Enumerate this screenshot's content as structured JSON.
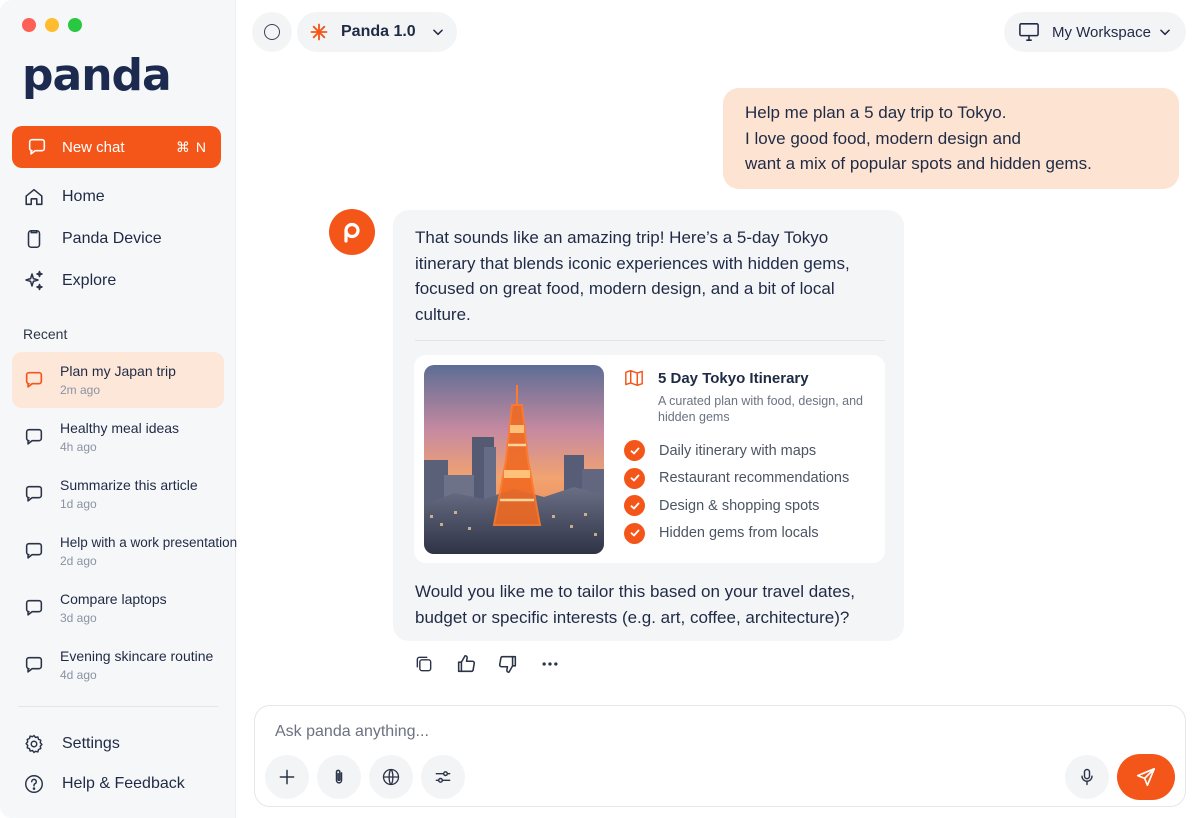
{
  "app": {
    "logo_text": "panda"
  },
  "sidebar": {
    "new_chat": {
      "label": "New chat",
      "shortcut": "⌘ N"
    },
    "nav": [
      {
        "label": "Home",
        "icon": "home-icon"
      },
      {
        "label": "Panda Device",
        "icon": "device-icon"
      },
      {
        "label": "Explore",
        "icon": "sparkle-icon"
      }
    ],
    "recent_label": "Recent",
    "recent": [
      {
        "title": "Plan my Japan trip",
        "ago": "2m ago",
        "active": true
      },
      {
        "title": "Healthy meal ideas",
        "ago": "4h ago"
      },
      {
        "title": "Summarize this article",
        "ago": "1d ago"
      },
      {
        "title": "Help with a work presentation",
        "ago": "2d ago"
      },
      {
        "title": "Compare laptops",
        "ago": "3d ago"
      },
      {
        "title": "Evening skincare routine",
        "ago": "4d ago"
      }
    ],
    "bottom": [
      {
        "label": "Settings",
        "icon": "gear-icon"
      },
      {
        "label": "Help & Feedback",
        "icon": "help-icon"
      }
    ]
  },
  "header": {
    "model_name": "Panda 1.0",
    "workspace_name": "My Workspace"
  },
  "chat": {
    "user_message_lines": [
      "Help me plan a 5 day trip to Tokyo.",
      "I love good food, modern design and",
      "want a mix of popular spots and hidden gems."
    ],
    "assistant_intro": "That sounds like an amazing trip! Here’s a 5-day Tokyo itinerary that blends iconic experiences with hidden gems, focused on great food, modern design, and a bit of local culture.",
    "card": {
      "title": "5 Day Tokyo Itinerary",
      "subtitle": "A curated plan with food, design, and hidden gems",
      "features": [
        "Daily itinerary with maps",
        "Restaurant recommendations",
        "Design & shopping spots",
        "Hidden gems from locals"
      ]
    },
    "assistant_followup": "Would you like me to tailor this based on your travel dates, budget or specific interests (e.g. art, coffee, architecture)?"
  },
  "composer": {
    "placeholder": "Ask panda anything..."
  },
  "colors": {
    "accent": "#f4561a",
    "user_bubble": "#fde3d2",
    "ai_bubble": "#f4f5f7",
    "active_item": "#fde7d9"
  }
}
